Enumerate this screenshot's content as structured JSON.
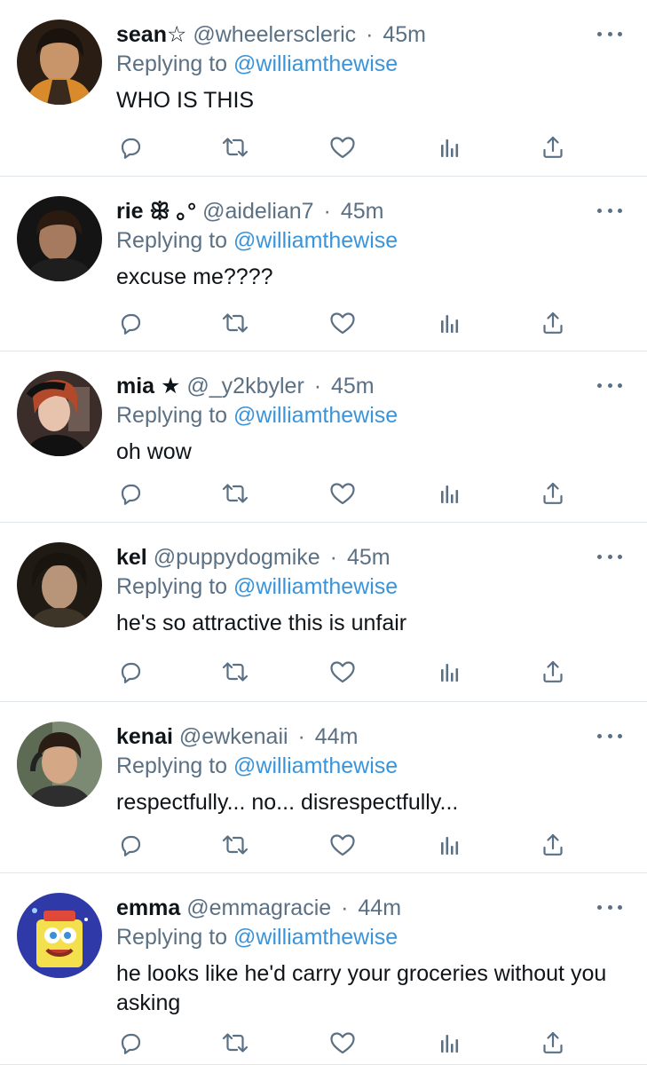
{
  "tweets": [
    {
      "name": "sean☆",
      "handle": "@wheelerscleric",
      "dot": "·",
      "time": "45m",
      "replying_prefix": "Replying to",
      "replying_to": "@williamthewise",
      "text": "WHO IS THIS"
    },
    {
      "name": "rie ꕥ ｡°",
      "handle": "@aidelian7",
      "dot": "·",
      "time": "45m",
      "replying_prefix": "Replying to",
      "replying_to": "@williamthewise",
      "text": "excuse me????"
    },
    {
      "name": "mia ★",
      "handle": "@_y2kbyler",
      "dot": "·",
      "time": "45m",
      "replying_prefix": "Replying to",
      "replying_to": "@williamthewise",
      "text": "oh wow"
    },
    {
      "name": "kel",
      "handle": "@puppydogmike",
      "dot": "·",
      "time": "45m",
      "replying_prefix": "Replying to",
      "replying_to": "@williamthewise",
      "text": "he's so attractive this is unfair"
    },
    {
      "name": "kenai",
      "handle": "@ewkenaii",
      "dot": "·",
      "time": "44m",
      "replying_prefix": "Replying to",
      "replying_to": "@williamthewise",
      "text": "respectfully... no... disrespectfully..."
    },
    {
      "name": "emma",
      "handle": "@emmagracie",
      "dot": "·",
      "time": "44m",
      "replying_prefix": "Replying to",
      "replying_to": "@williamthewise",
      "text": "he looks like he'd carry your groceries without you asking"
    }
  ],
  "icons": {
    "more": "more-horizontal-icon",
    "reply": "reply-icon",
    "retweet": "retweet-icon",
    "like": "like-heart-icon",
    "views": "analytics-icon",
    "share": "share-icon"
  },
  "colors": {
    "text": "#0f1419",
    "secondary": "#5b7083",
    "link": "#3b94d9",
    "divider": "#e1e6ea"
  }
}
